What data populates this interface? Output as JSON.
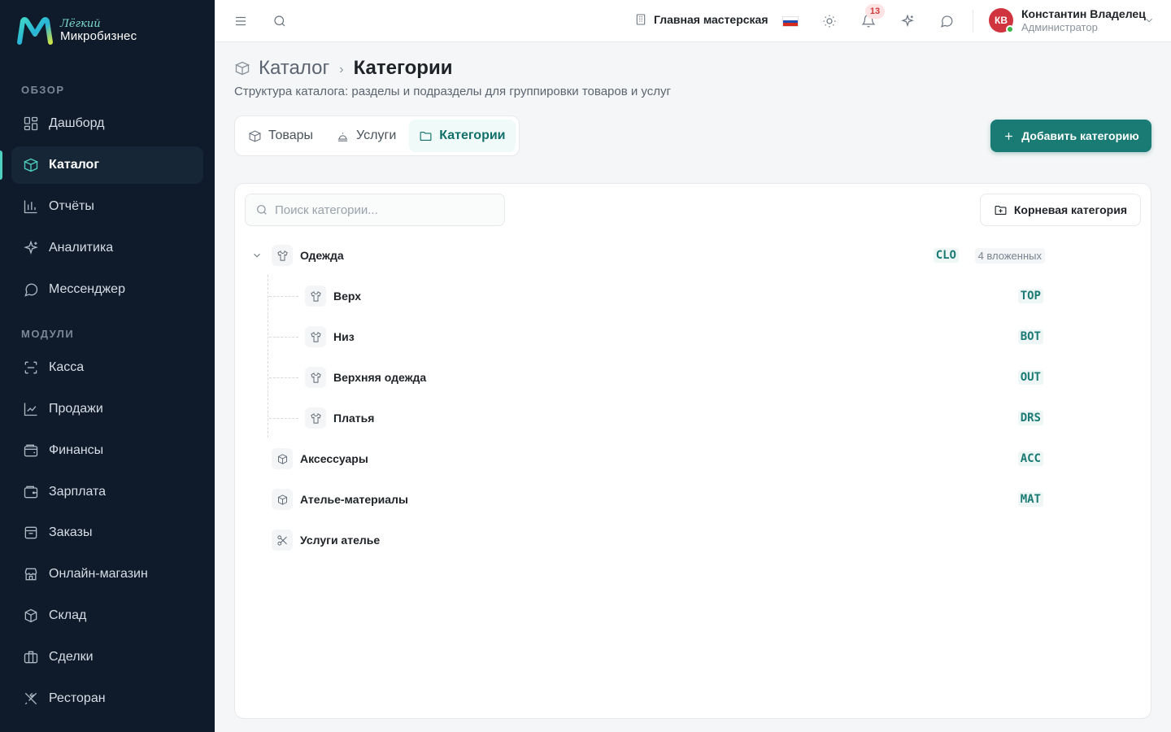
{
  "app": {
    "logo_sub": "Лёгкий",
    "logo_main": "Микробизнес"
  },
  "sidebar": {
    "section_overview": "ОБЗОР",
    "section_modules": "МОДУЛИ",
    "items": [
      {
        "label": "Дашборд",
        "icon": "dashboard-icon"
      },
      {
        "label": "Каталог",
        "icon": "catalog-icon",
        "active": true
      },
      {
        "label": "Отчёты",
        "icon": "reports-icon"
      },
      {
        "label": "Аналитика",
        "icon": "sparkle-icon"
      },
      {
        "label": "Мессенджер",
        "icon": "chat-icon"
      },
      {
        "label": "Касса",
        "icon": "scan-icon"
      },
      {
        "label": "Продажи",
        "icon": "chart-line-icon"
      },
      {
        "label": "Финансы",
        "icon": "wallet-icon"
      },
      {
        "label": "Зарплата",
        "icon": "wallet-icon"
      },
      {
        "label": "Заказы",
        "icon": "package-icon"
      },
      {
        "label": "Онлайн-магазин",
        "icon": "store-icon"
      },
      {
        "label": "Склад",
        "icon": "box-icon"
      },
      {
        "label": "Сделки",
        "icon": "briefcase-icon"
      },
      {
        "label": "Ресторан",
        "icon": "utensils-icon"
      }
    ]
  },
  "topbar": {
    "workshop": "Главная мастерская",
    "notifications_count": "13",
    "user_initials": "КВ",
    "user_name": "Константин Владелец",
    "user_role": "Администратор"
  },
  "header": {
    "crumb_parent": "Каталог",
    "crumb_separator": "›",
    "crumb_current": "Категории",
    "subtitle": "Структура каталога: разделы и подразделы для группировки товаров и услуг"
  },
  "tabs": [
    {
      "label": "Товары",
      "active": false
    },
    {
      "label": "Услуги",
      "active": false
    },
    {
      "label": "Категории",
      "active": true
    }
  ],
  "actions": {
    "add_category": "Добавить категорию",
    "root_category": "Корневая категория"
  },
  "search": {
    "placeholder": "Поиск категории...",
    "value": ""
  },
  "categories": [
    {
      "name": "Одежда",
      "code": "CLO",
      "count": "4 вложенных",
      "icon": "shirt-icon",
      "expanded": true,
      "children": [
        {
          "name": "Верх",
          "code": "TOP",
          "icon": "shirt-icon"
        },
        {
          "name": "Низ",
          "code": "BOT",
          "icon": "shirt-icon"
        },
        {
          "name": "Верхняя одежда",
          "code": "OUT",
          "icon": "shirt-icon"
        },
        {
          "name": "Платья",
          "code": "DRS",
          "icon": "shirt-icon"
        }
      ]
    },
    {
      "name": "Аксессуары",
      "code": "ACC",
      "icon": "box-icon"
    },
    {
      "name": "Ателье-материалы",
      "code": "MAT",
      "icon": "box-icon"
    },
    {
      "name": "Услуги ателье",
      "code": "",
      "icon": "scissors-icon"
    }
  ],
  "colors": {
    "sidebar_bg": "#0f1b2a",
    "accent": "#1a7a74",
    "accent_light": "#4dd0c0",
    "badge": "#d33a3a"
  }
}
